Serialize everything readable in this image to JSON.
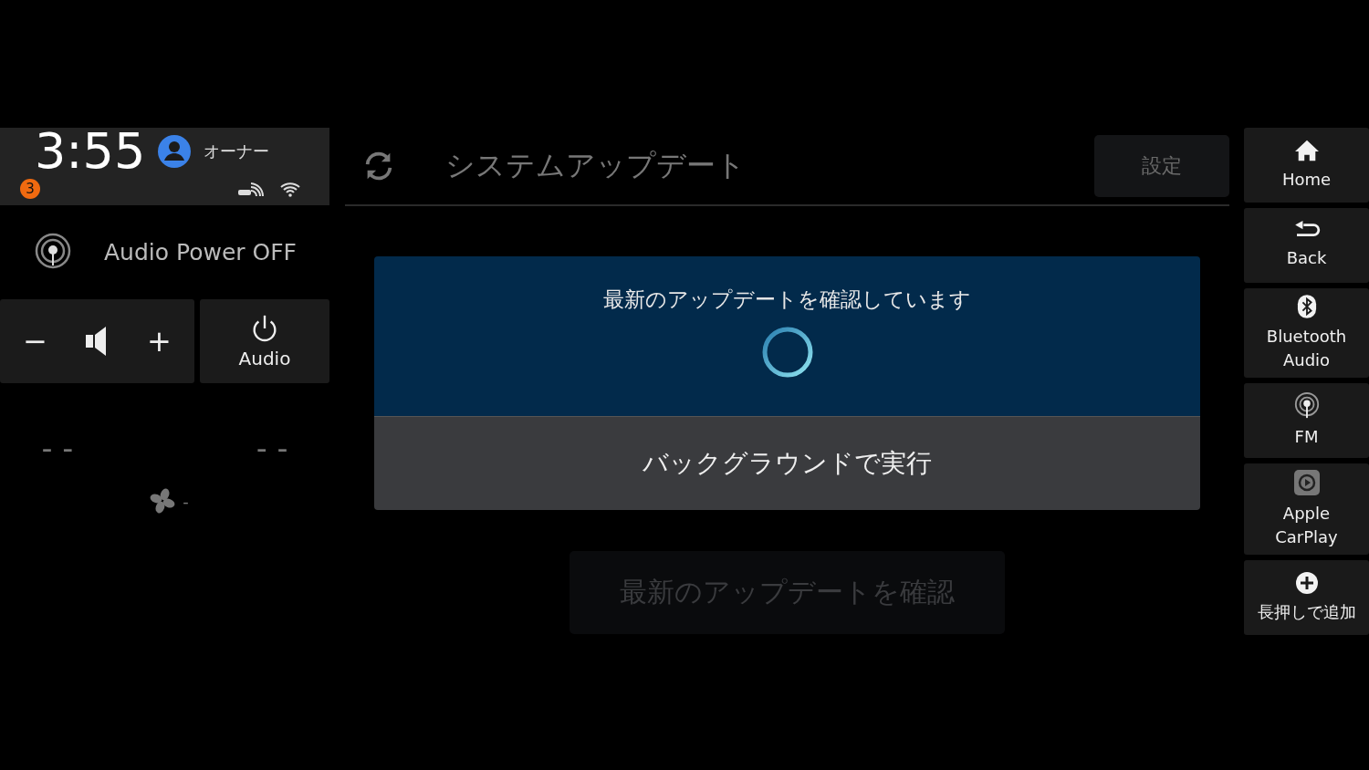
{
  "status": {
    "time": "3:55",
    "user": "オーナー",
    "notifications": "3"
  },
  "audio": {
    "source": "Audio Power OFF",
    "volume_down": "−",
    "volume_up": "+",
    "power_label": "Audio"
  },
  "climate": {
    "left_temp": "– –",
    "right_temp": "– –",
    "fan_speed": "-"
  },
  "header": {
    "title": "システムアップデート",
    "settings": "設定"
  },
  "dialog": {
    "message": "最新のアップデートを確認しています",
    "action": "バックグラウンドで実行"
  },
  "check_button": {
    "label": "最新のアップデートを確認",
    "disabled": true
  },
  "nav": [
    {
      "kind": "home",
      "lines": [
        "Home"
      ]
    },
    {
      "kind": "back",
      "lines": [
        "Back"
      ]
    },
    {
      "kind": "bluetooth",
      "lines": [
        "Bluetooth",
        "Audio"
      ]
    },
    {
      "kind": "radio",
      "lines": [
        "FM"
      ]
    },
    {
      "kind": "carplay",
      "lines": [
        "Apple",
        "CarPlay"
      ]
    },
    {
      "kind": "add",
      "lines": [
        "長押しで追加"
      ]
    }
  ]
}
